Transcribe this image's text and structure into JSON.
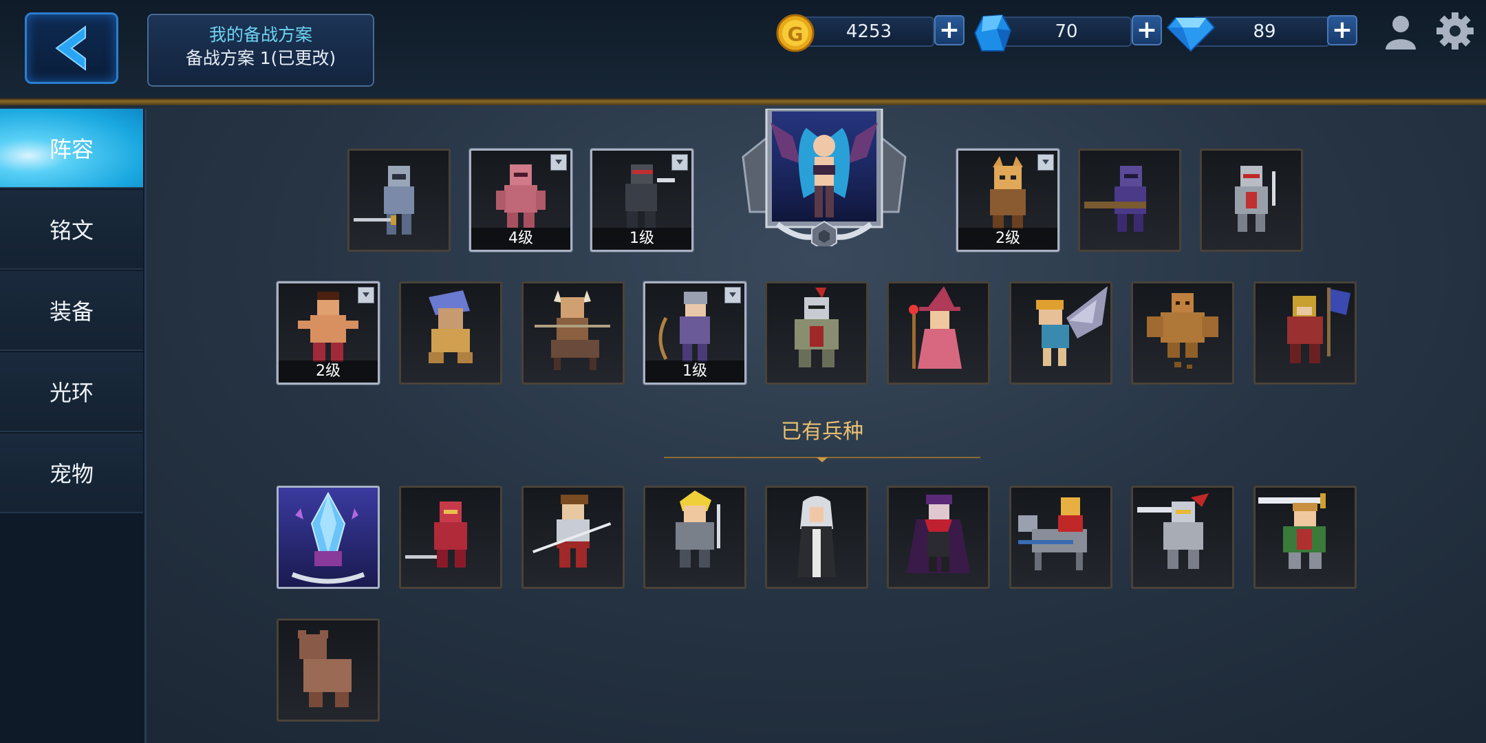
{
  "header": {
    "plan_title": "我的备战方案",
    "plan_subtitle": "备战方案 1(已更改)"
  },
  "currency": {
    "gold": "4253",
    "crystal": "70",
    "diamond": "89",
    "plus": "+"
  },
  "sidebar": {
    "items": [
      {
        "label": "阵容",
        "active": true
      },
      {
        "label": "铭文",
        "active": false
      },
      {
        "label": "装备",
        "active": false
      },
      {
        "label": "光环",
        "active": false
      },
      {
        "label": "宠物",
        "active": false
      }
    ]
  },
  "lineup": {
    "leader": {
      "name": "succubus"
    },
    "row1": [
      {
        "name": "armored-knight",
        "level": "",
        "flag": false
      },
      {
        "name": "mummy",
        "level": "4级",
        "flag": true
      },
      {
        "name": "ninja",
        "level": "1级",
        "flag": true
      },
      {
        "name": "beast-warrior",
        "level": "2级",
        "flag": true
      },
      {
        "name": "crossbow-knight",
        "level": "",
        "flag": false
      },
      {
        "name": "skeleton-knight",
        "level": "",
        "flag": false
      }
    ],
    "row2": [
      {
        "name": "brawler",
        "level": "2级",
        "flag": true
      },
      {
        "name": "goblin",
        "level": "",
        "flag": false
      },
      {
        "name": "centaur",
        "level": "",
        "flag": false
      },
      {
        "name": "archer",
        "level": "1级",
        "flag": true
      },
      {
        "name": "heavy-knight",
        "level": "",
        "flag": false
      },
      {
        "name": "witch",
        "level": "",
        "flag": false
      },
      {
        "name": "harpy",
        "level": "",
        "flag": false
      },
      {
        "name": "golem",
        "level": "",
        "flag": false
      },
      {
        "name": "banner-warrior",
        "level": "",
        "flag": false
      }
    ]
  },
  "owned": {
    "title": "已有兵种",
    "units": [
      {
        "name": "crystal-totem"
      },
      {
        "name": "red-knight"
      },
      {
        "name": "samurai"
      },
      {
        "name": "blonde-swordsman"
      },
      {
        "name": "nun"
      },
      {
        "name": "vampire"
      },
      {
        "name": "cavalry"
      },
      {
        "name": "paladin"
      },
      {
        "name": "greatsword-hero"
      },
      {
        "name": "werebear"
      }
    ]
  },
  "colors": {
    "accent": "#1aa8e0",
    "gold_text": "#e8c070",
    "plan_title": "#6fd4f2"
  }
}
